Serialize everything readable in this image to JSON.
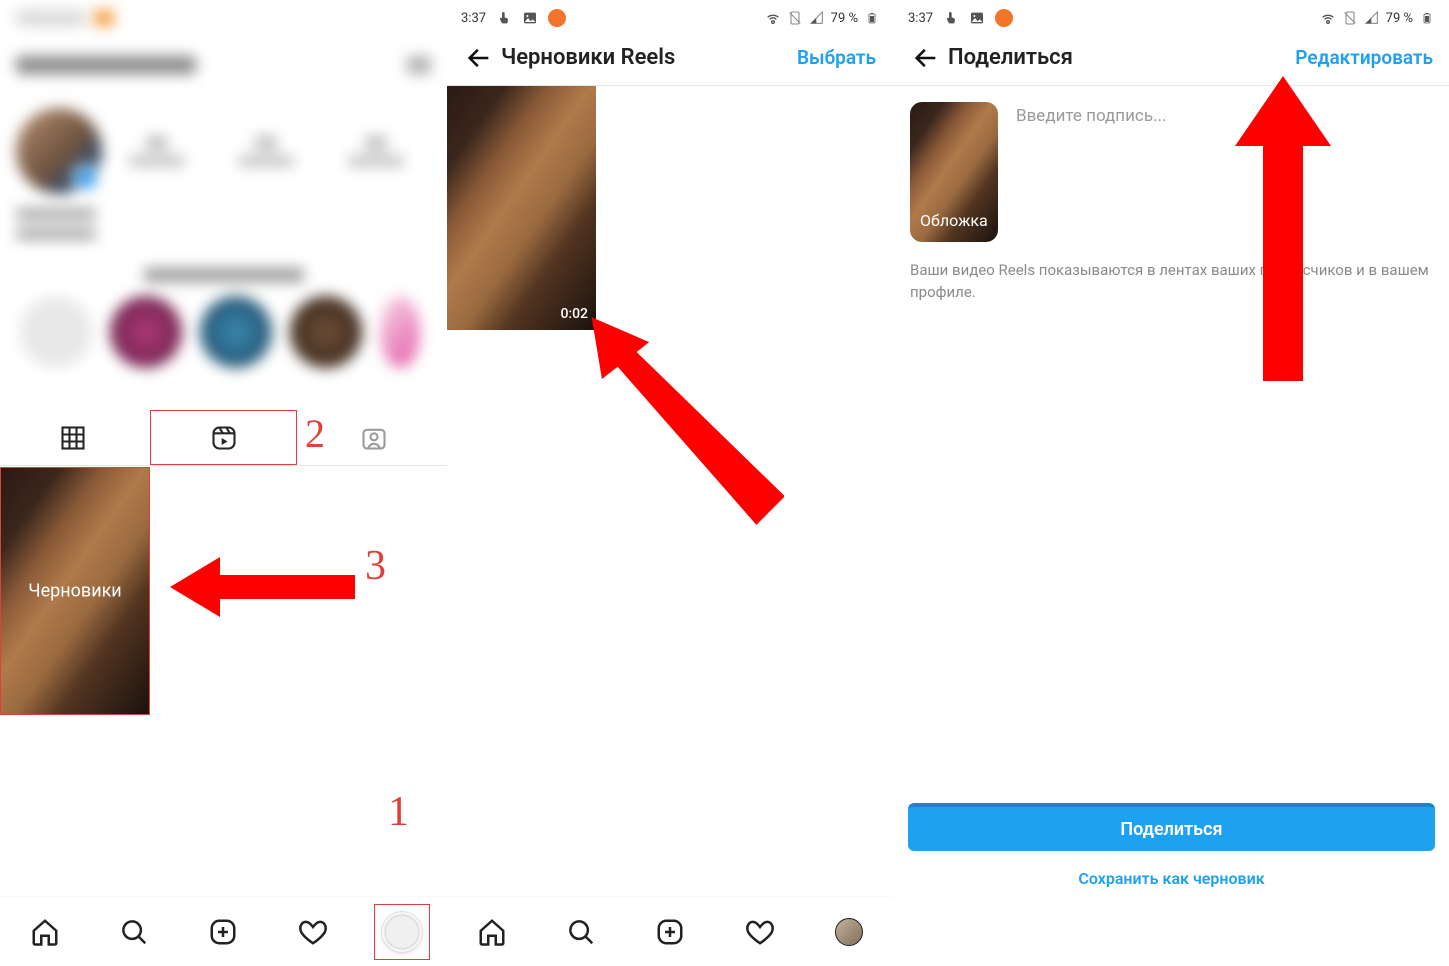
{
  "status": {
    "time": "3:37",
    "battery": "79 %"
  },
  "phone1": {
    "draft_label": "Черновики",
    "annot": {
      "n1": "1",
      "n2": "2",
      "n3": "3"
    }
  },
  "phone2": {
    "title": "Черновики Reels",
    "select": "Выбрать",
    "duration": "0:02"
  },
  "phone3": {
    "title": "Поделиться",
    "edit": "Редактировать",
    "cover": "Обложка",
    "caption_placeholder": "Введите подпись...",
    "note": "Ваши видео Reels показываются в лентах ваших подписчиков и в вашем профиле.",
    "share_btn": "Поделиться",
    "save_draft": "Сохранить как черновик"
  }
}
